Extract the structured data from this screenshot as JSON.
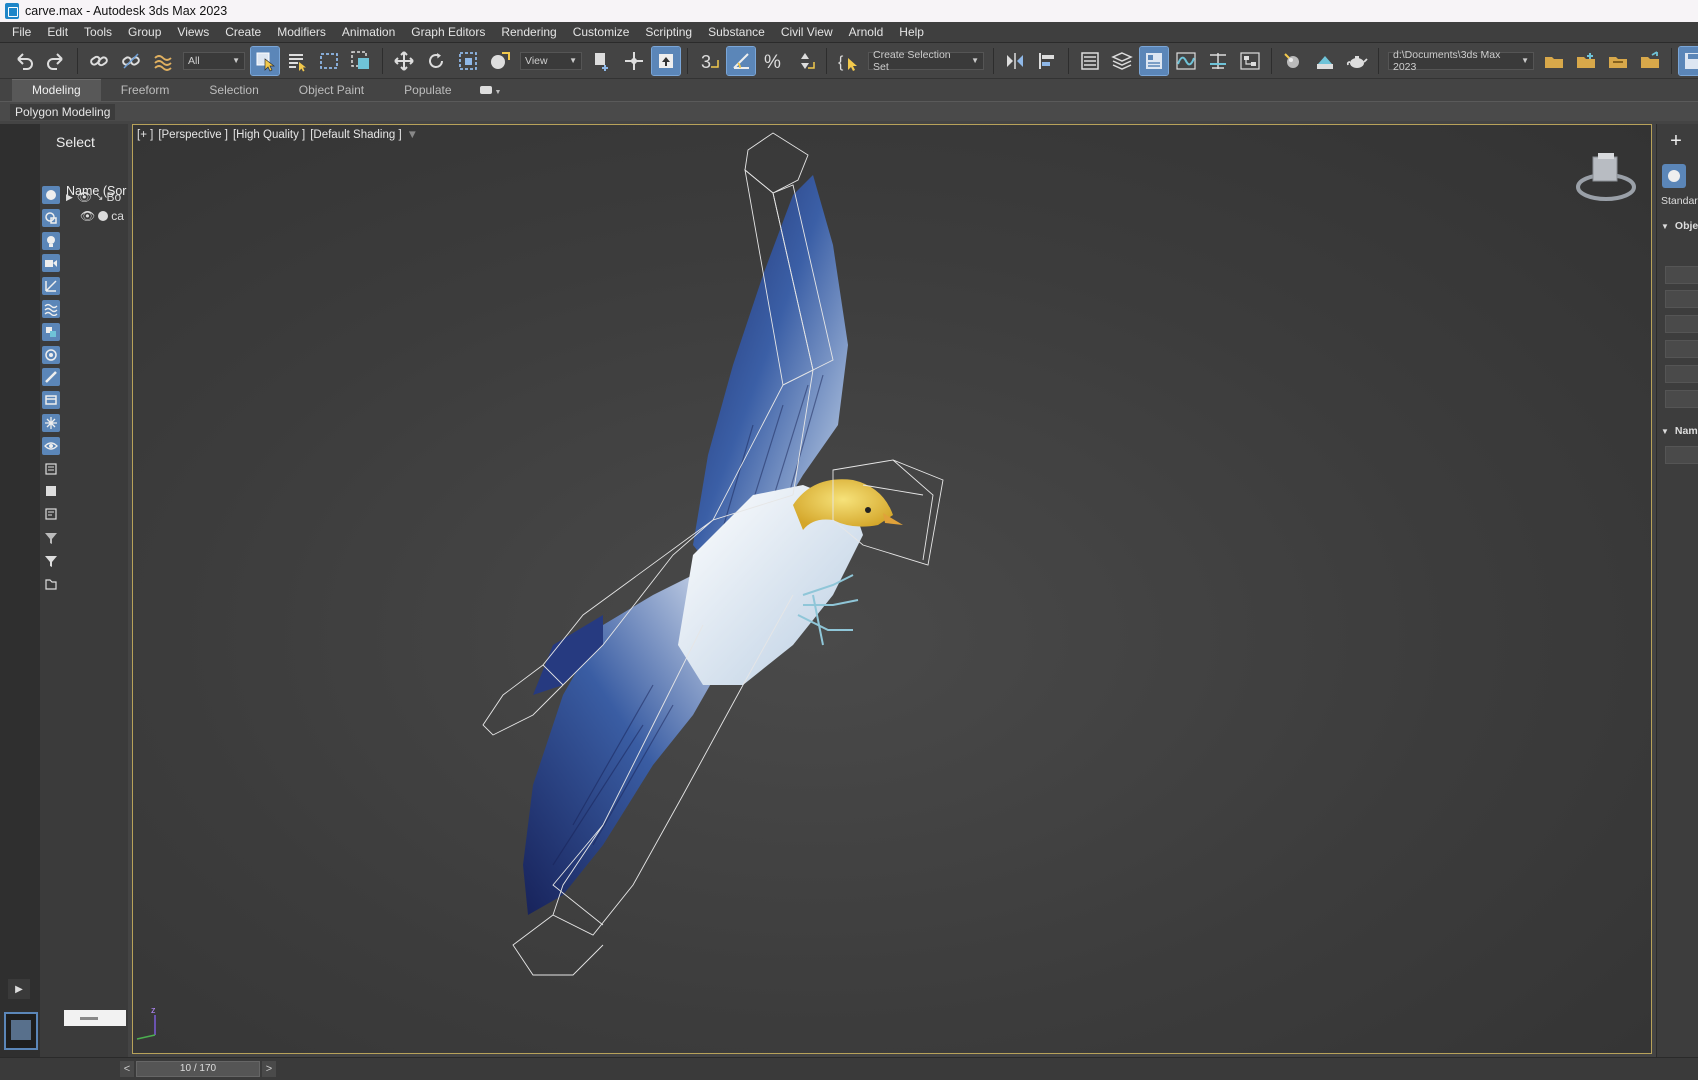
{
  "window": {
    "title": "carve.max - Autodesk 3ds Max 2023"
  },
  "menu": [
    "File",
    "Edit",
    "Tools",
    "Group",
    "Views",
    "Create",
    "Modifiers",
    "Animation",
    "Graph Editors",
    "Rendering",
    "Customize",
    "Scripting",
    "Substance",
    "Civil View",
    "Arnold",
    "Help"
  ],
  "toolbar": {
    "filter_value": "All",
    "ref_coord_value": "View",
    "selection_set_value": "Create Selection Set",
    "project_path": "d:\\Documents\\3ds Max 2023",
    "snap_toggle": "3",
    "angle_snap_icon": "angle-snap-icon",
    "percent_snap": "%"
  },
  "ribbon": {
    "tabs": [
      "Modeling",
      "Freeform",
      "Selection",
      "Object Paint",
      "Populate"
    ],
    "active_tab": "Modeling",
    "panel_label": "Polygon Modeling"
  },
  "scene_explorer": {
    "title": "Select",
    "column_header": "Name (Sor",
    "rows": [
      {
        "label": "Bo",
        "expandable": true
      },
      {
        "label": "ca",
        "expandable": false
      }
    ]
  },
  "viewport": {
    "labels": [
      "[+ ]",
      "[Perspective ]",
      "[High Quality ]",
      "[Default Shading ]"
    ],
    "axis_z": "z",
    "model": "eagle"
  },
  "command_panel": {
    "dropdown": "Standard",
    "rollout_object": "Obje",
    "rollout_name": "Nam"
  },
  "timeline": {
    "frame_display": "10 / 170",
    "prev": "<",
    "next": ">"
  },
  "colors": {
    "accent": "#5b86b8",
    "viewport_border": "#b8a25a",
    "background": "#444444"
  }
}
